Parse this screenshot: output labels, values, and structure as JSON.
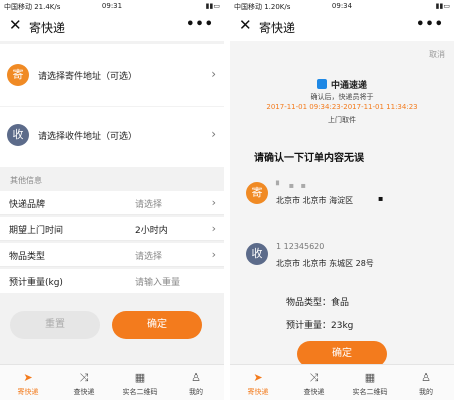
{
  "left": {
    "status": {
      "signal": "中国移动 21.4K/s",
      "time": "09:31",
      "battery": "▮▮▭"
    },
    "title": "寄快递",
    "close_icon": "✕",
    "more_icon": "•••",
    "sender": {
      "badge": "寄",
      "label": "请选择寄件地址（可选）"
    },
    "receiver": {
      "badge": "收",
      "label": "请选择收件地址（可选）"
    },
    "section_title": "其他信息",
    "fields": [
      {
        "label": "快递品牌",
        "value": "请选择"
      },
      {
        "label": "期望上门时间",
        "value": "2小时内"
      },
      {
        "label": "物品类型",
        "value": "请选择"
      },
      {
        "label": "预计重量(kg)",
        "value": "请输入重量"
      }
    ],
    "buttons": {
      "reset": "重置",
      "confirm": "确定"
    }
  },
  "right": {
    "status": {
      "signal": "中国移动 1.20K/s",
      "time": "09:34",
      "battery": "▮▮▭"
    },
    "title": "寄快递",
    "close_icon": "✕",
    "more_icon": "•••",
    "cancel": "取消",
    "courier_name": "中通速递",
    "note_line1": "确认后，快递员将于",
    "note_time": "2017-11-01 09:34:23-2017-11-01 11:34:23",
    "note_line3": "上门取件",
    "confirm_title": "请确认一下订单内容无误",
    "sender": {
      "badge": "寄",
      "masked": "▘ ▪ ▪",
      "address": "北京市 北京市 海淀区",
      "masked2": "▪"
    },
    "receiver": {
      "badge": "收",
      "phone": "1 12345620",
      "address": "北京市 北京市 东城区 28号"
    },
    "item_type_label": "物品类型：",
    "item_type": "食品",
    "weight_label": "预计重量：",
    "weight": "23kg",
    "confirm_button": "确定"
  },
  "tabs": [
    {
      "label": "寄快递",
      "icon": "➤"
    },
    {
      "label": "查快递",
      "icon": "⤨"
    },
    {
      "label": "实名二维码",
      "icon": "▦"
    },
    {
      "label": "我的",
      "icon": "♙"
    }
  ],
  "colors": {
    "accent": "#f37b1d",
    "sender_badge": "#f08a24",
    "receiver_badge": "#5c6b8a"
  }
}
